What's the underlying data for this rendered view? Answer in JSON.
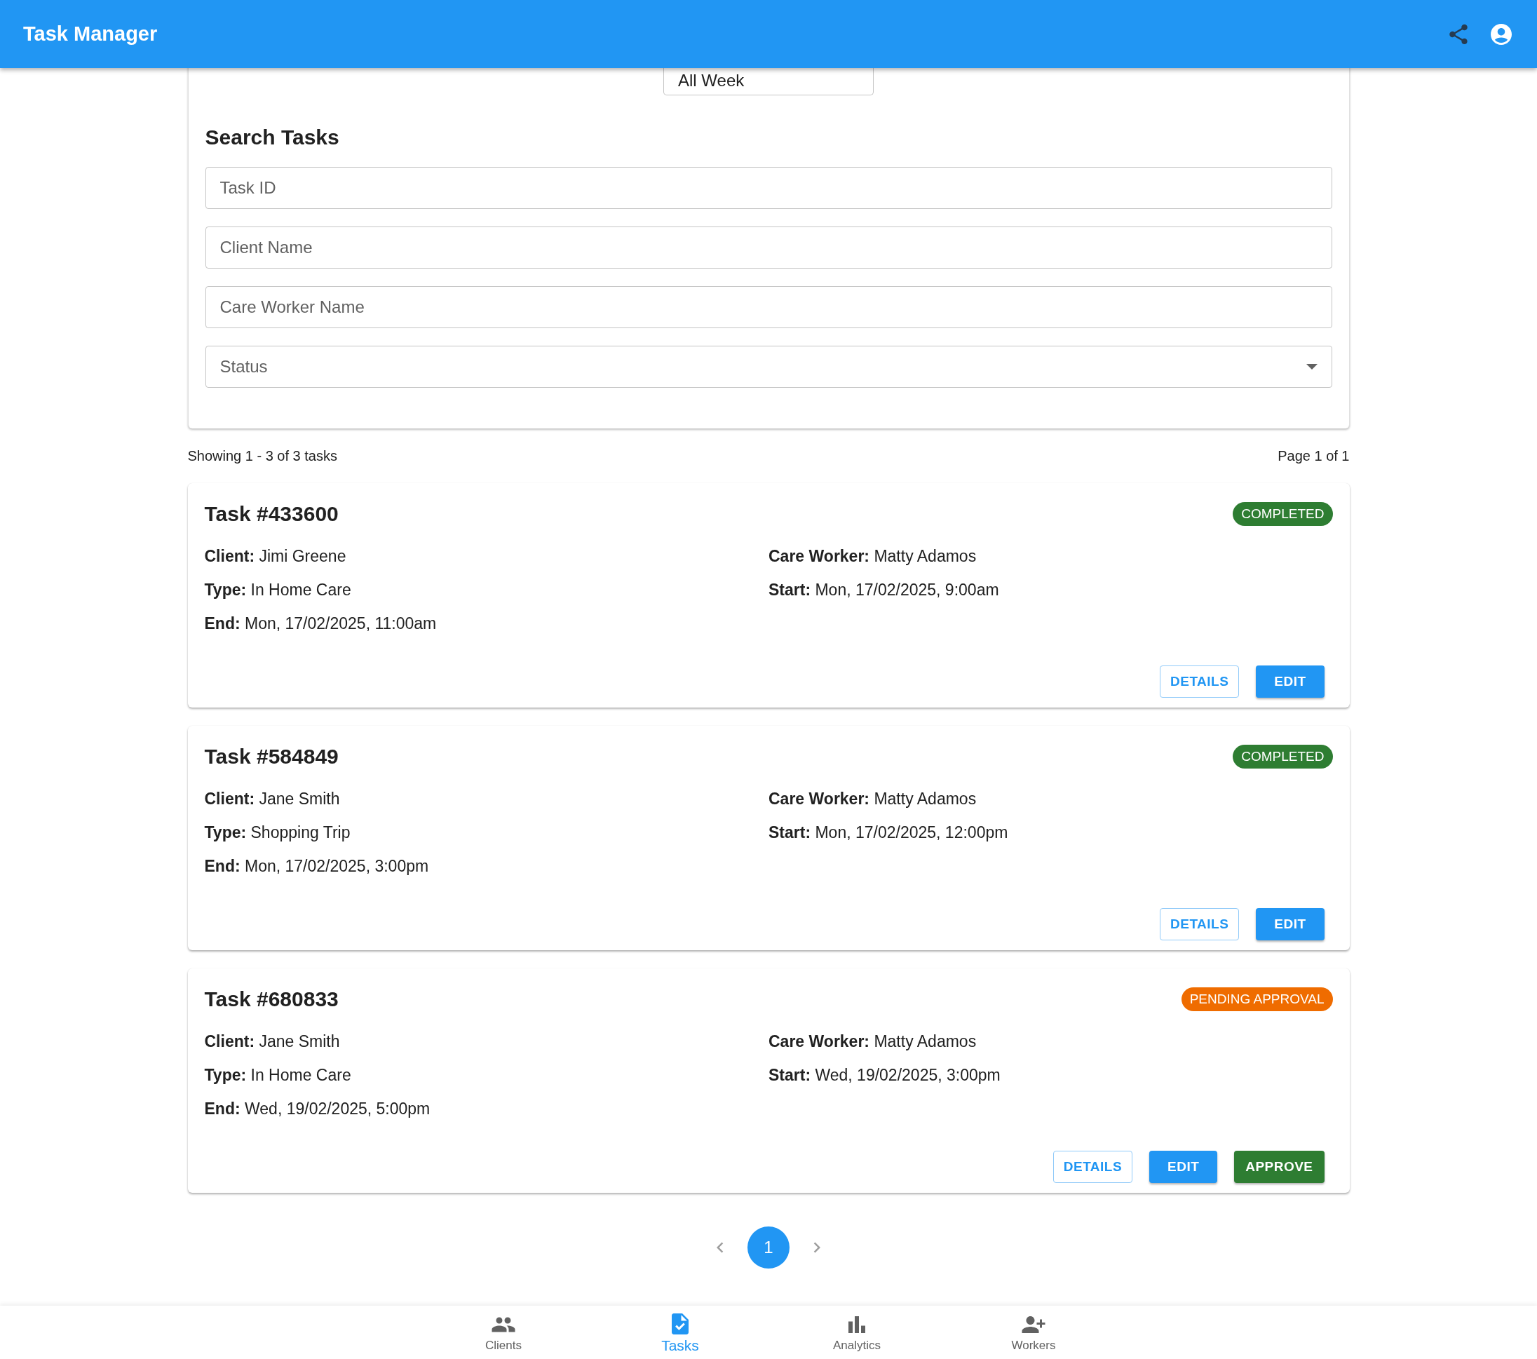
{
  "app_bar": {
    "title": "Task Manager"
  },
  "period_field": {
    "value": "All Week"
  },
  "search": {
    "title": "Search Tasks",
    "fields": [
      {
        "placeholder": "Task ID",
        "kind": "text"
      },
      {
        "placeholder": "Client Name",
        "kind": "text"
      },
      {
        "placeholder": "Care Worker Name",
        "kind": "text"
      },
      {
        "placeholder": "Status",
        "kind": "select"
      }
    ]
  },
  "summary": {
    "showing": "Showing 1 - 3 of 3 tasks",
    "page": "Page 1 of 1"
  },
  "tasks": [
    {
      "title": "Task #433600",
      "status": "COMPLETED",
      "color": "#2e7d32",
      "fields": [
        {
          "label": "Client:",
          "value": "Jimi Greene"
        },
        {
          "label": "Care Worker:",
          "value": "Matty Adamos"
        },
        {
          "label": "Type:",
          "value": "In Home Care"
        },
        {
          "label": "Start:",
          "value": "Mon, 17/02/2025, 9:00am"
        },
        {
          "label": "End:",
          "value": "Mon, 17/02/2025, 11:00am"
        }
      ],
      "buttons": [
        {
          "label": "DETAILS",
          "kind": "outlined"
        },
        {
          "label": "EDIT",
          "kind": "primary"
        }
      ]
    },
    {
      "title": "Task #584849",
      "status": "COMPLETED",
      "color": "#2e7d32",
      "fields": [
        {
          "label": "Client:",
          "value": "Jane Smith"
        },
        {
          "label": "Care Worker:",
          "value": "Matty Adamos"
        },
        {
          "label": "Type:",
          "value": "Shopping Trip"
        },
        {
          "label": "Start:",
          "value": "Mon, 17/02/2025, 12:00pm"
        },
        {
          "label": "End:",
          "value": "Mon, 17/02/2025, 3:00pm"
        }
      ],
      "buttons": [
        {
          "label": "DETAILS",
          "kind": "outlined"
        },
        {
          "label": "EDIT",
          "kind": "primary"
        }
      ]
    },
    {
      "title": "Task #680833",
      "status": "PENDING APPROVAL",
      "color": "#ef6c00",
      "fields": [
        {
          "label": "Client:",
          "value": "Jane Smith"
        },
        {
          "label": "Care Worker:",
          "value": "Matty Adamos"
        },
        {
          "label": "Type:",
          "value": "In Home Care"
        },
        {
          "label": "Start:",
          "value": "Wed, 19/02/2025, 3:00pm"
        },
        {
          "label": "End:",
          "value": "Wed, 19/02/2025, 5:00pm"
        }
      ],
      "buttons": [
        {
          "label": "DETAILS",
          "kind": "outlined"
        },
        {
          "label": "EDIT",
          "kind": "primary"
        },
        {
          "label": "APPROVE",
          "kind": "success"
        }
      ]
    }
  ],
  "pagination": {
    "pages": [
      {
        "label": "1",
        "selected": true
      }
    ]
  },
  "bottom_nav": [
    {
      "label": "Clients",
      "kind": "people",
      "selected": false
    },
    {
      "label": "Tasks",
      "kind": "task",
      "selected": true
    },
    {
      "label": "Analytics",
      "kind": "chart",
      "selected": false
    },
    {
      "label": "Workers",
      "kind": "person-add",
      "selected": false
    }
  ]
}
